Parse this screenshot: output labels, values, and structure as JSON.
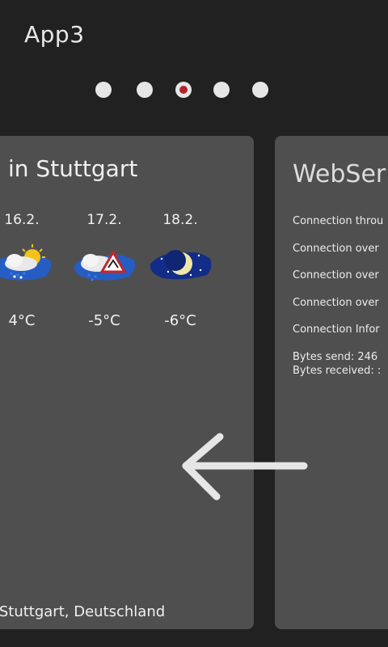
{
  "header": {
    "app_title": "App3"
  },
  "pager": {
    "pages": 5,
    "active_index": 2,
    "active_color": "#b3242a"
  },
  "weather": {
    "title": "in Stuttgart",
    "days": [
      {
        "date": "16.2.",
        "icon": "rain-snow-sun-icon",
        "temp": "4°C"
      },
      {
        "date": "17.2.",
        "icon": "rain-warning-icon",
        "temp": "-5°C"
      },
      {
        "date": "18.2.",
        "icon": "night-moon-icon",
        "temp": "-6°C"
      }
    ],
    "location": "t: Stuttgart, Deutschland"
  },
  "webserver": {
    "title": "WebSer",
    "lines": [
      "Connection throu",
      "Connection over",
      "Connection over",
      "Connection over",
      "Connection Infor"
    ],
    "bytes_send": "Bytes send: 246",
    "bytes_received": "Bytes received: :"
  },
  "gesture": {
    "icon": "swipe-left-arrow-icon"
  }
}
